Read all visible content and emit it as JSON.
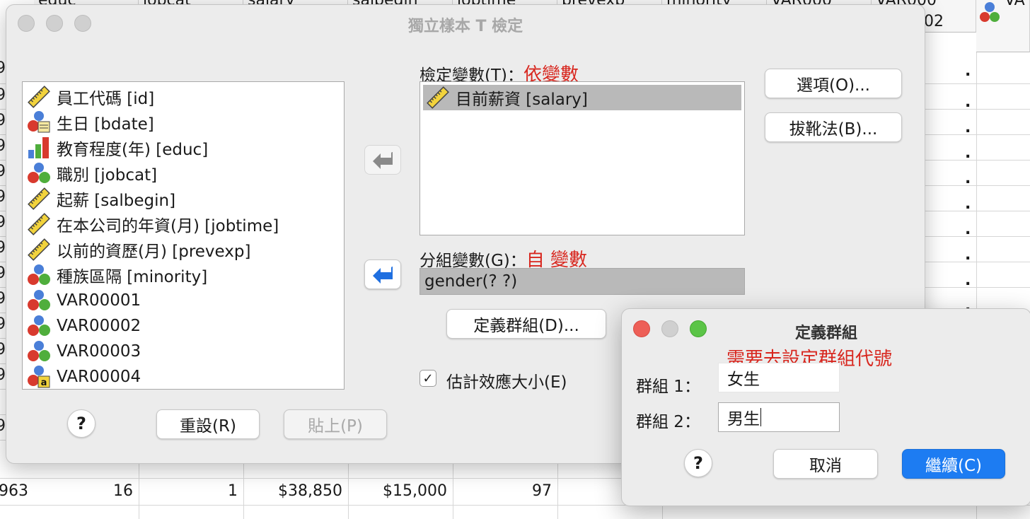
{
  "spreadsheet": {
    "headers": [
      "educ",
      "jobcat",
      "salary",
      "salbegin",
      "jobtime",
      "prevexp",
      "minority",
      "VAR000",
      "VAR000",
      "VA"
    ],
    "header_sub": "02",
    "row_marks": [
      "9",
      "9",
      "9",
      "9",
      "9",
      "9",
      "9",
      "9",
      "9",
      "9",
      "9",
      "9",
      "9",
      "9"
    ],
    "dot": ".",
    "last_row": {
      "id": "963",
      "educ": "16",
      "jobcat": "1",
      "salary": "$38,850",
      "salbegin": "$15,000",
      "jobtime": "97"
    }
  },
  "main_dialog": {
    "title": "獨立樣本 T 檢定",
    "variables": [
      {
        "label": "員工代碼  [id]",
        "icon": "ruler-scale-icon"
      },
      {
        "label": "生日 [bdate]",
        "icon": "nominal-date-icon"
      },
      {
        "label": "教育程度(年) [educ]",
        "icon": "ordinal-bars-icon"
      },
      {
        "label": "職別 [jobcat]",
        "icon": "nominal-icon"
      },
      {
        "label": "起薪 [salbegin]",
        "icon": "ruler-scale-icon"
      },
      {
        "label": "在本公司的年資(月) [jobtime]",
        "icon": "ruler-scale-icon"
      },
      {
        "label": "以前的資歷(月) [prevexp]",
        "icon": "ruler-scale-icon"
      },
      {
        "label": "種族區隔 [minority]",
        "icon": "nominal-icon"
      },
      {
        "label": "VAR00001",
        "icon": "nominal-icon"
      },
      {
        "label": "VAR00002",
        "icon": "nominal-icon"
      },
      {
        "label": "VAR00003",
        "icon": "nominal-icon"
      },
      {
        "label": "VAR00004",
        "icon": "nominal-string-icon"
      }
    ],
    "test_var_label": "檢定變數(T)：",
    "test_var_note": "依變數",
    "test_var_selected": "目前薪資 [salary]",
    "group_var_label": "分組變數(G)：",
    "group_var_note": "自 變數",
    "group_var_value": "gender(? ?)",
    "options_button": "選項(O)...",
    "bootstrap_button": "拔靴法(B)...",
    "define_groups_button": "定義群組(D)...",
    "effect_size_label": "估計效應大小(E)",
    "effect_size_checked": true,
    "help_label": "?",
    "reset_button": "重設(R)",
    "paste_button": "貼上(P)"
  },
  "define_groups_dialog": {
    "title": "定義群組",
    "note": "需要去設定群組代號",
    "group1_label": "群組 1：",
    "group1_value": "女生",
    "group2_label": "群組 2：",
    "group2_value": "男生",
    "help_label": "?",
    "cancel_button": "取消",
    "continue_button": "繼續(C)"
  },
  "colors": {
    "accent": "#1d7cf2",
    "note_red": "#d8271f",
    "arrow_blue": "#1f6fe0"
  }
}
